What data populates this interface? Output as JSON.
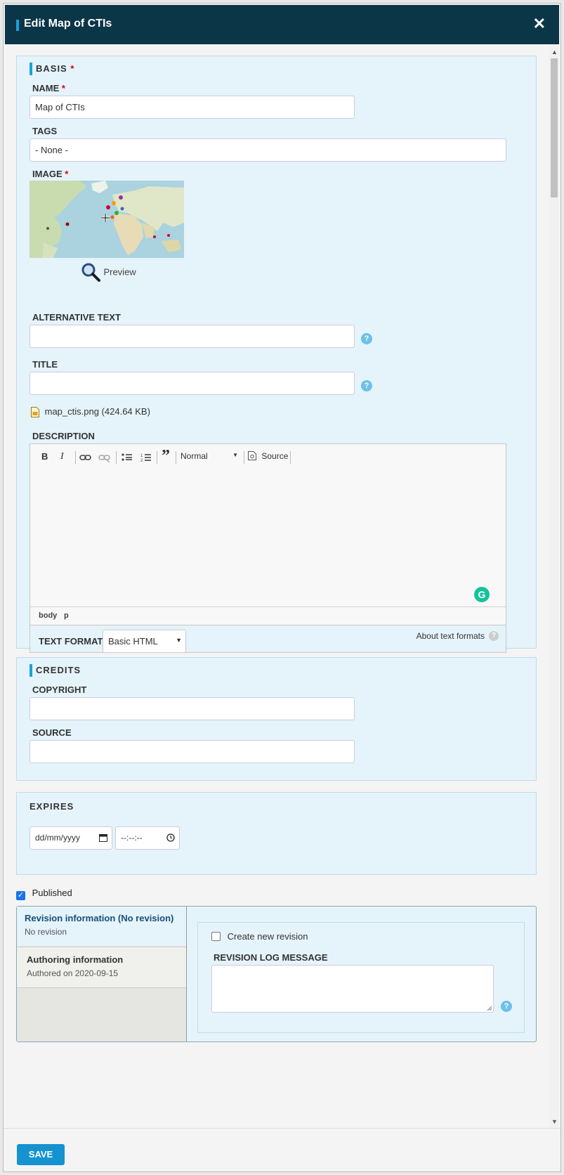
{
  "dialog": {
    "title": "Edit Map of CTIs",
    "close_symbol": "✕"
  },
  "basis": {
    "legend": "BASIS",
    "name_label": "NAME",
    "name_value": "Map of CTIs",
    "tags_label": "TAGS",
    "tags_value": "- None -",
    "image_label": "IMAGE",
    "preview_label": "Preview",
    "alt_label": "ALTERNATIVE TEXT",
    "title_label": "TITLE",
    "file_name": "map_ctis.png (424.64 KB)",
    "description_label": "DESCRIPTION",
    "editor": {
      "bold": "B",
      "italic": "I",
      "format_value": "Normal",
      "source_label": "Source",
      "path_body": "body",
      "path_p": "p"
    },
    "text_format_label": "TEXT FORMAT",
    "text_format_value": "Basic HTML",
    "about_formats": "About text formats"
  },
  "credits": {
    "legend": "CREDITS",
    "copyright_label": "COPYRIGHT",
    "source_label": "SOURCE"
  },
  "expires": {
    "legend": "EXPIRES",
    "date_placeholder": "dd/mm/yyyy",
    "time_placeholder": "--:--:--"
  },
  "published": {
    "label": "Published",
    "checked": true
  },
  "revision": {
    "title": "Revision information (No revision)",
    "summary": "No revision",
    "authoring_title": "Authoring information",
    "authoring_summary": "Authored on 2020-09-15",
    "create_new_label": "Create new revision",
    "log_label": "REVISION LOG MESSAGE"
  },
  "footer": {
    "save_label": "SAVE"
  },
  "colors": {
    "header": "#0b3648",
    "accent": "#19a3d6",
    "panel": "#e5f3fb",
    "save": "#1592d0"
  },
  "help_symbol": "?"
}
